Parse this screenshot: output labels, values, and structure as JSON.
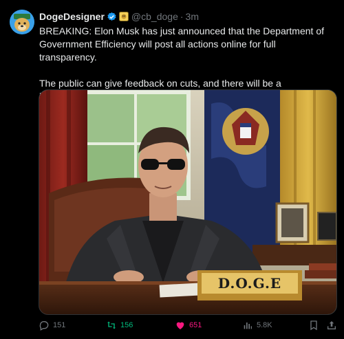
{
  "author": {
    "name": "DogeDesigner",
    "handle": "@cb_doge",
    "separator": "·",
    "time": "3m",
    "avatar_icon": "doge-avatar-icon",
    "verified_icon": "verified-badge-icon",
    "affiliate_icon": "affiliate-badge-icon",
    "verified_color": "#1d9bf0"
  },
  "post": {
    "paragraph1": "BREAKING: Elon Musk has just announced that the Department of Government Efficiency will post all actions online for full transparency.",
    "paragraph2": "The public can give feedback on cuts, and there will be a leaderboard highlighting the most dumb government spending."
  },
  "media": {
    "placard": "D.O.G.E"
  },
  "actions": {
    "replies": "151",
    "reposts": "156",
    "likes": "651",
    "views": "5.8K",
    "repost_color": "#00ba7c",
    "like_color": "#f91880"
  }
}
